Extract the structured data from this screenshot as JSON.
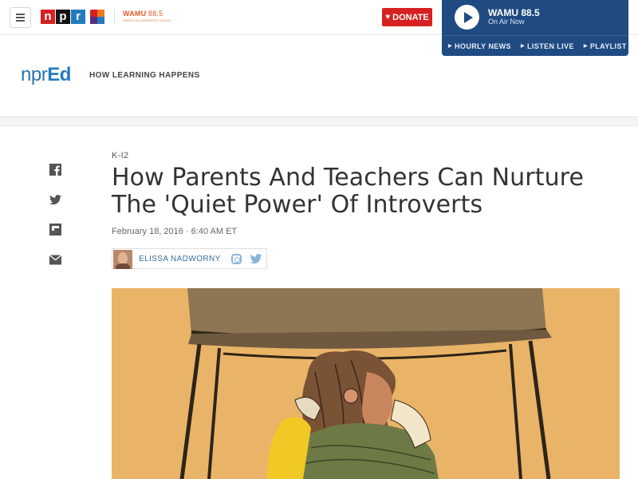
{
  "header": {
    "npr_logo": [
      "n",
      "p",
      "r"
    ],
    "wamu_logo": "WAMU",
    "wamu_frequency": "88.5",
    "wamu_subtitle": "AMERICAN UNIVERSITY RADIO",
    "donate_label": "DONATE",
    "icons": {
      "menu": "hamburger-icon",
      "donate": "heart-icon"
    }
  },
  "player": {
    "station": "WAMU 88.5",
    "status": "On Air Now",
    "links": [
      "HOURLY NEWS",
      "LISTEN LIVE",
      "PLAYLIST"
    ],
    "colors": {
      "background": "#1f4a82"
    }
  },
  "brand": {
    "logo_light": "npr",
    "logo_bold": "Ed",
    "tagline": "HOW LEARNING HAPPENS"
  },
  "share": {
    "icons": [
      "facebook-icon",
      "twitter-icon",
      "flipboard-icon",
      "email-icon"
    ]
  },
  "article": {
    "slug": "K-I2",
    "headline": "How Parents And Teachers Can Nurture The 'Quiet Power' Of Introverts",
    "date": "February 18, 2016 · 6:40 AM ET",
    "author": "ELISSA NADWORNY",
    "author_icons": [
      "instagram-icon",
      "twitter-icon"
    ]
  },
  "colors": {
    "npr_red": "#d62021",
    "npr_blue": "#237bbd",
    "link_blue": "#3a6fa0",
    "illustration_bg": "#e9b468"
  }
}
